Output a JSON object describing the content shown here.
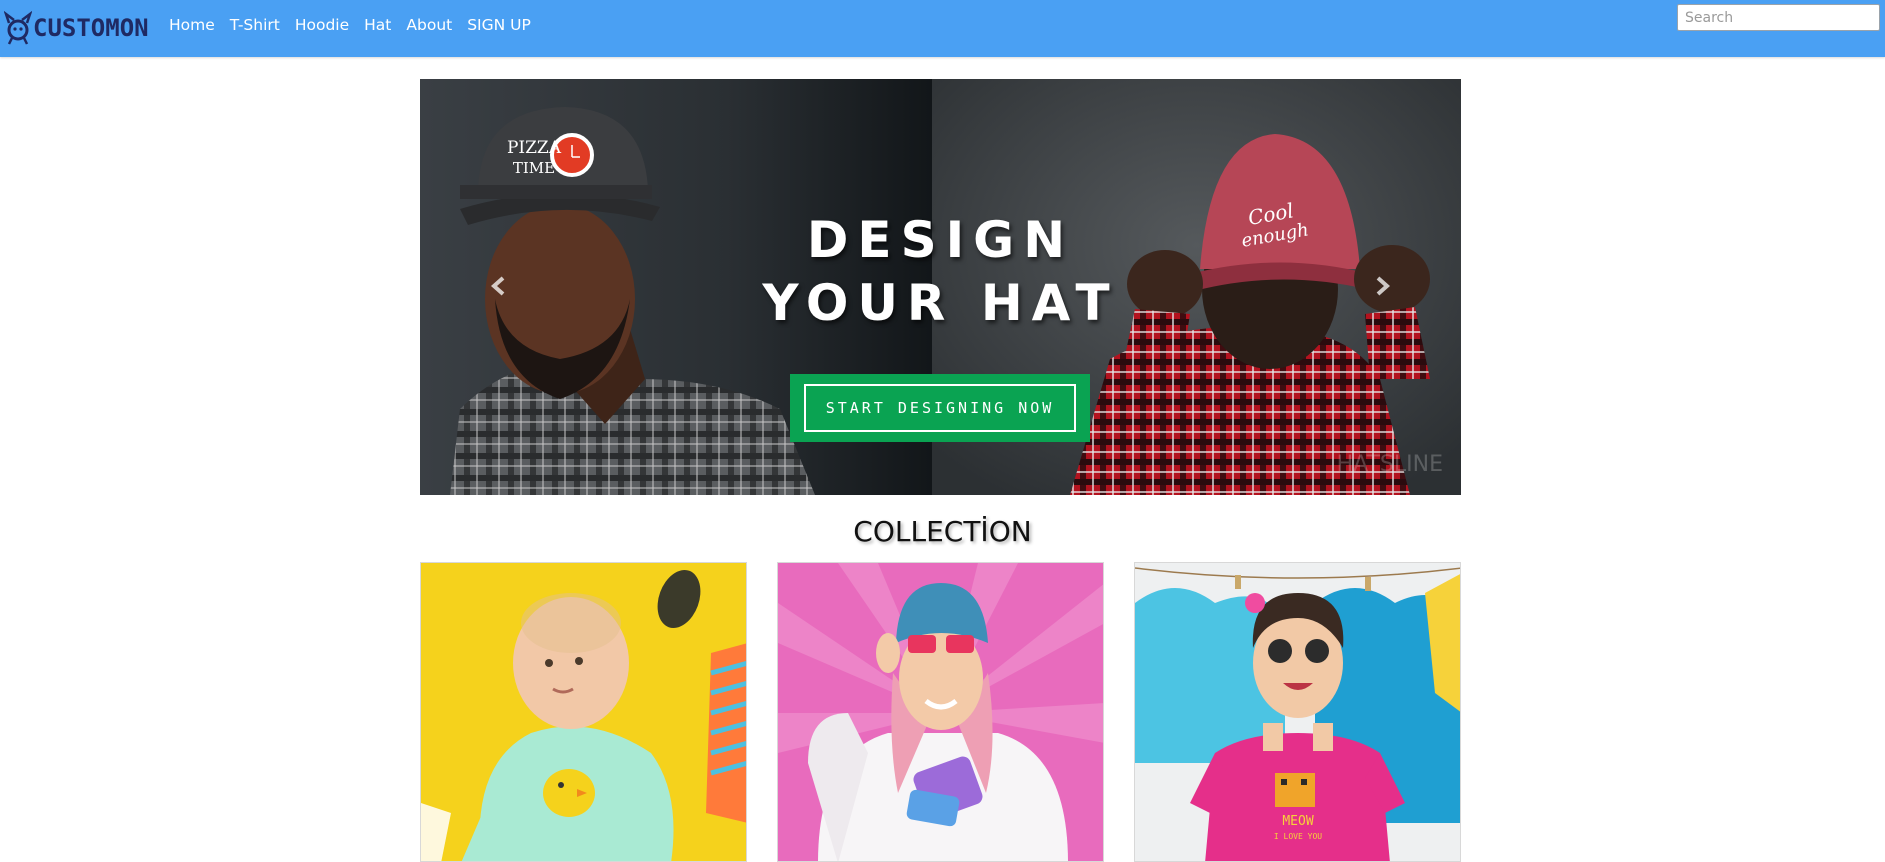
{
  "navbar": {
    "brand": "CUSTOMON",
    "links": [
      "Home",
      "T-Shirt",
      "Hoodie",
      "Hat",
      "About",
      "SIGN UP"
    ],
    "search": {
      "placeholder": "Search",
      "value": ""
    },
    "background_color": "#4aa0f3"
  },
  "hero": {
    "heading_line1": "DESIGN",
    "heading_line2": "YOUR HAT",
    "cta_label": "START DESIGNING NOW",
    "cta_color": "#0aa352",
    "watermark": "HATSLINE",
    "left_cap_text_line1": "PIZZA",
    "left_cap_text_line2": "TIME",
    "right_cap_text_line1": "Cool",
    "right_cap_text_line2": "enough",
    "prev_icon": "chevron-left-icon",
    "next_icon": "chevron-right-icon"
  },
  "collection": {
    "title": "COLLECTİON",
    "items": [
      {
        "name": "baby-onesie",
        "background": "#f5d21c"
      },
      {
        "name": "pink-sweatshirt",
        "background": "#e86bbd"
      },
      {
        "name": "kids-meow-tshirt",
        "background": "#eef0f1",
        "shirt_text_line1": "MEOW",
        "shirt_text_line2": "I LOVE YOU"
      }
    ]
  }
}
